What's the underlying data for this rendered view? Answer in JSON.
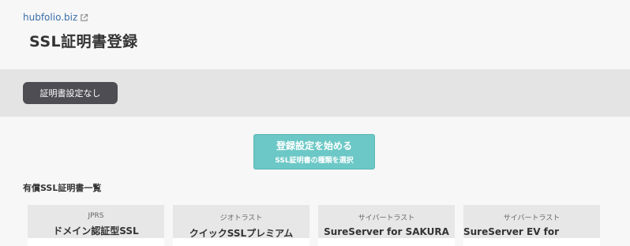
{
  "header": {
    "domain": "hubfolio.biz",
    "title": "SSL証明書登録"
  },
  "toolbar": {
    "no_cert_label": "証明書設定なし"
  },
  "start": {
    "main_label": "登録設定を始める",
    "sub_label": "SSL証明書の種類を選択"
  },
  "section": {
    "heading": "有償SSL証明書一覧"
  },
  "cards": [
    {
      "provider": "JPRS",
      "name": "ドメイン認証型SSL"
    },
    {
      "provider": "ジオトラスト",
      "name": "クイックSSLプレミアム"
    },
    {
      "provider": "サイバートラスト",
      "name": "SureServer for SAKURA"
    },
    {
      "provider": "サイバートラスト",
      "name": "SureServer EV for SAKURA"
    }
  ],
  "colors": {
    "accent": "#6cc8c6",
    "dark_button": "#4d4d53",
    "link": "#3c6fa8"
  }
}
